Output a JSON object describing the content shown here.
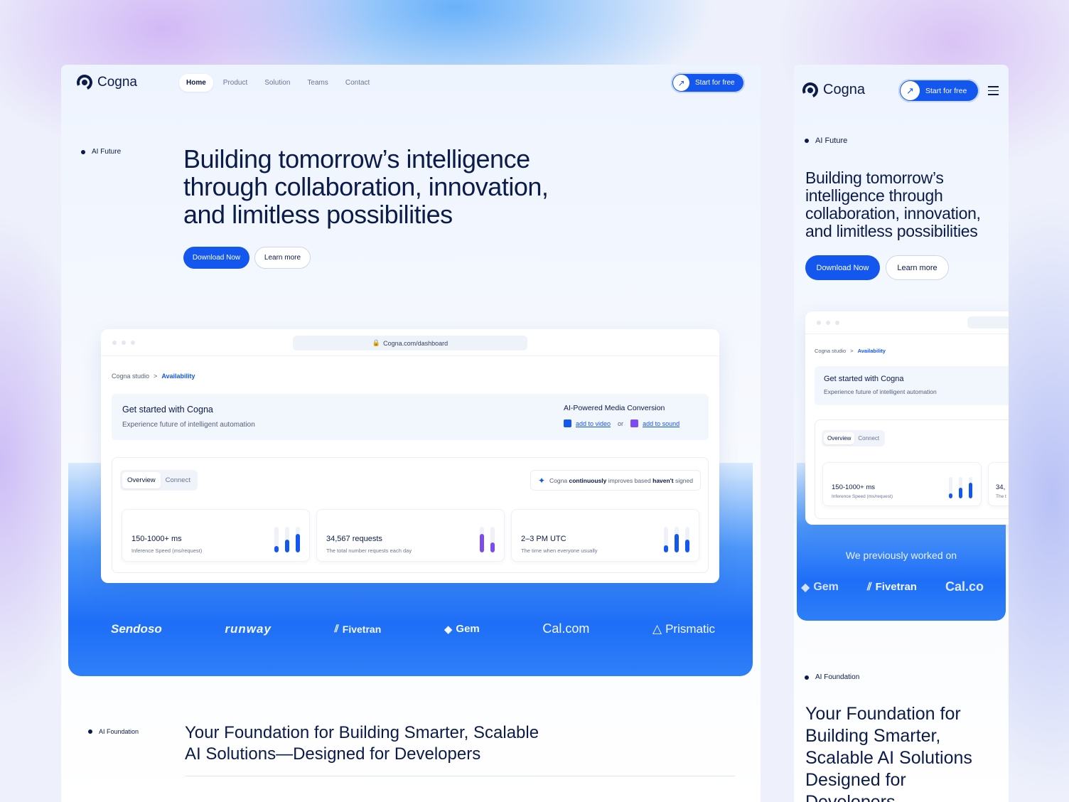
{
  "brand": {
    "name": "Cogna"
  },
  "nav": {
    "items": [
      "Home",
      "Product",
      "Solution",
      "Teams",
      "Contact"
    ],
    "active": "Home"
  },
  "cta": {
    "label": "Start for free"
  },
  "hero": {
    "tag": "AI Future",
    "title_desktop": [
      "Building tomorrow’s intelligence",
      "through collaboration, innovation,",
      "and limitless possibilities"
    ],
    "title_mobile": [
      "Building tomorrow’s",
      "intelligence through",
      "collaboration, innovation,",
      "and limitless possibilities"
    ],
    "primary_button": "Download Now",
    "secondary_button": "Learn more"
  },
  "dashboard": {
    "url": "Cogna.com/dashboard",
    "breadcrumb": {
      "root": "Cogna studio",
      "separator": ">",
      "current": "Availability"
    },
    "get_started": {
      "title": "Get started with Cogna",
      "subtitle": "Experience future of intelligent automation"
    },
    "media": {
      "title": "AI-Powered Media Conversion",
      "video_link": "add to video",
      "or": "or",
      "sound_link": "add to sound"
    },
    "tabs": [
      "Overview",
      "Connect"
    ],
    "notice": {
      "brand": "Cogna",
      "bold1": "continuously",
      "mid": "improves based",
      "bold2": "haven't",
      "end": "signed"
    },
    "stats": [
      {
        "value": "150-1000+ ms",
        "label": "Inference Speed (ms/request)",
        "bars": [
          0.25,
          0.5,
          0.72
        ],
        "color": "#1357ee"
      },
      {
        "value": "34,567 requests",
        "label": "The total number requests each day",
        "bars": [
          0.72,
          0.4
        ],
        "color": "#7b4cf0"
      },
      {
        "value": "2–3 PM UTC",
        "label": "The time when everyone usually",
        "bars": [
          0.28,
          0.72,
          0.5
        ],
        "color": "#1357ee"
      }
    ],
    "mobile_stat_partial": {
      "value": "34,",
      "label": "The t"
    }
  },
  "partners": {
    "heading_mobile": "We previously worked on",
    "desktop": [
      "Sendoso",
      "runway",
      "Fivetran",
      "Gem",
      "Cal.com",
      "Prismatic"
    ],
    "mobile": [
      "Gem",
      "Fivetran",
      "Cal.co"
    ]
  },
  "foundation": {
    "tag": "AI Foundation",
    "title_desktop": [
      "Your Foundation for Building Smarter, Scalable",
      "AI Solutions—Designed for Developers"
    ],
    "title_mobile": [
      "Your Foundation for",
      "Building Smarter,",
      "Scalable AI Solutions",
      "Designed for",
      "Developers"
    ]
  },
  "colors": {
    "accent": "#1357ee",
    "ink": "#0b1b4a",
    "purple": "#7b4cf0"
  }
}
